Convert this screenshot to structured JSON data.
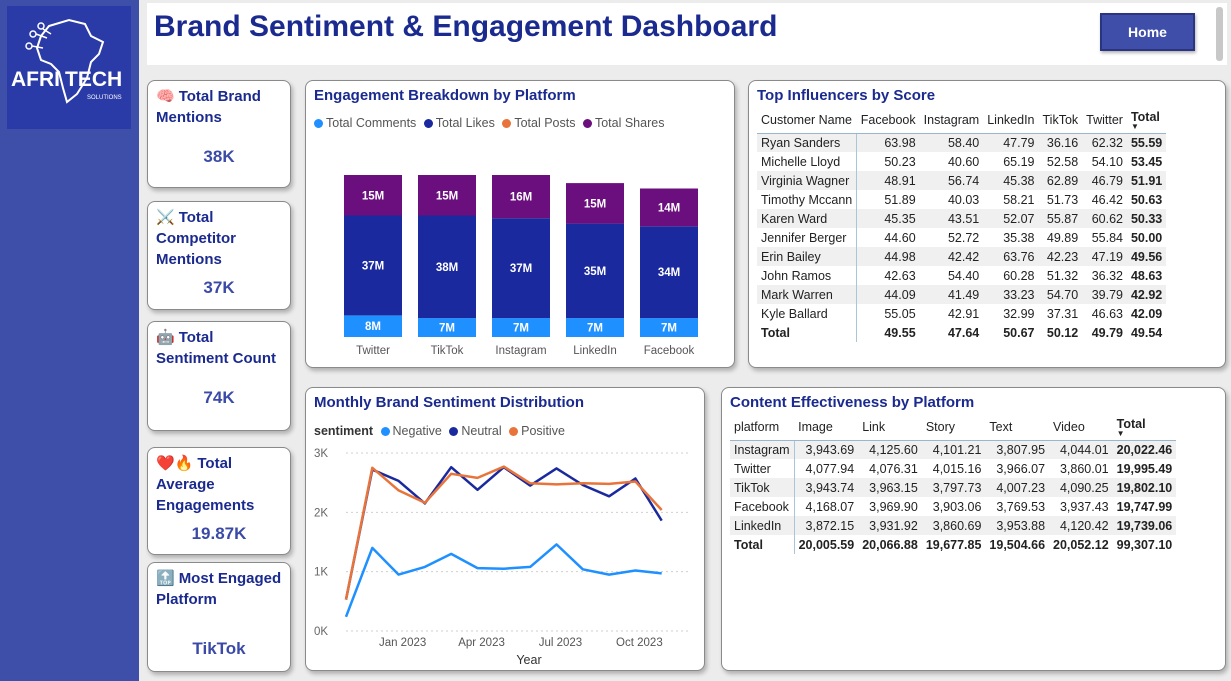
{
  "app": {
    "title": "Brand Sentiment & Engagement Dashboard",
    "home_label": "Home",
    "logo": {
      "line1": "AFRI",
      "line2": "TECH",
      "line3": "SOLUTIONS"
    }
  },
  "kpis": [
    {
      "title": "Total Brand Mentions",
      "value": "38K",
      "icon": "brain-emoji"
    },
    {
      "title": "Total Competitor Mentions",
      "value": "37K",
      "icon": "crossed-swords-emoji"
    },
    {
      "title": "Total Sentiment Count",
      "value": "74K",
      "icon": "robot-emoji"
    },
    {
      "title": "Total Average Engagements",
      "value": "19.87K",
      "icon": "heart-fire-emoji"
    },
    {
      "title": "Most Engaged Platform",
      "value": "TikTok",
      "icon": "top-arrow-emoji"
    }
  ],
  "engagement_chart": {
    "title": "Engagement Breakdown by Platform",
    "legend": [
      {
        "label": "Total Comments",
        "color": "#1e90ff"
      },
      {
        "label": "Total Likes",
        "color": "#1a2a9e"
      },
      {
        "label": "Total Posts",
        "color": "#e8743b"
      },
      {
        "label": "Total Shares",
        "color": "#6b0f7e"
      }
    ],
    "chart_data": {
      "type": "bar",
      "stacked": true,
      "categories": [
        "Twitter",
        "TikTok",
        "Instagram",
        "LinkedIn",
        "Facebook"
      ],
      "series": [
        {
          "name": "Total Comments",
          "values": [
            8,
            7,
            7,
            7,
            7
          ],
          "labels": [
            "8M",
            "7M",
            "7M",
            "7M",
            "7M"
          ]
        },
        {
          "name": "Total Likes",
          "values": [
            37,
            38,
            37,
            35,
            34
          ],
          "labels": [
            "37M",
            "38M",
            "37M",
            "35M",
            "34M"
          ]
        },
        {
          "name": "Total Shares",
          "values": [
            15,
            15,
            16,
            15,
            14
          ],
          "labels": [
            "15M",
            "15M",
            "16M",
            "15M",
            "14M"
          ]
        }
      ],
      "unit": "M"
    }
  },
  "sentiment_chart": {
    "title": "Monthly Brand Sentiment Distribution",
    "legend_title": "sentiment",
    "legend": [
      {
        "label": "Negative",
        "color": "#1e90ff"
      },
      {
        "label": "Neutral",
        "color": "#1a2a9e"
      },
      {
        "label": "Positive",
        "color": "#e8743b"
      }
    ],
    "chart_data": {
      "type": "line",
      "x": [
        "2022-11",
        "2022-12",
        "2023-01",
        "2023-02",
        "2023-03",
        "2023-04",
        "2023-05",
        "2023-06",
        "2023-07",
        "2023-08",
        "2023-09",
        "2023-10",
        "2023-11",
        "2023-12"
      ],
      "series": [
        {
          "name": "Negative",
          "values": [
            240,
            1400,
            950,
            1080,
            1300,
            1060,
            1050,
            1080,
            1460,
            1040,
            950,
            1020,
            970,
            null
          ]
        },
        {
          "name": "Neutral",
          "values": [
            530,
            2720,
            2530,
            2150,
            2760,
            2380,
            2760,
            2450,
            2740,
            2460,
            2270,
            2570,
            1860,
            null
          ]
        },
        {
          "name": "Positive",
          "values": [
            530,
            2750,
            2370,
            2160,
            2650,
            2580,
            2770,
            2490,
            2470,
            2490,
            2480,
            2520,
            2040,
            null
          ]
        }
      ],
      "xlabel": "Year",
      "xticks": [
        "Jan 2023",
        "Apr 2023",
        "Jul 2023",
        "Oct 2023"
      ],
      "yticks": [
        "0K",
        "1K",
        "2K",
        "3K"
      ],
      "ylim": [
        0,
        3000
      ],
      "grid": true
    }
  },
  "influencers": {
    "title": "Top Influencers by Score",
    "columns": [
      "Customer Name",
      "Facebook",
      "Instagram",
      "LinkedIn",
      "TikTok",
      "Twitter",
      "Total"
    ],
    "rows": [
      [
        "Ryan Sanders",
        "63.98",
        "58.40",
        "47.79",
        "36.16",
        "62.32",
        "55.59"
      ],
      [
        "Michelle Lloyd",
        "50.23",
        "40.60",
        "65.19",
        "52.58",
        "54.10",
        "53.45"
      ],
      [
        "Virginia Wagner",
        "48.91",
        "56.74",
        "45.38",
        "62.89",
        "46.79",
        "51.91"
      ],
      [
        "Timothy Mccann",
        "51.89",
        "40.03",
        "58.21",
        "51.73",
        "46.42",
        "50.63"
      ],
      [
        "Karen Ward",
        "45.35",
        "43.51",
        "52.07",
        "55.87",
        "60.62",
        "50.33"
      ],
      [
        "Jennifer Berger",
        "44.60",
        "52.72",
        "35.38",
        "49.89",
        "55.84",
        "50.00"
      ],
      [
        "Erin Bailey",
        "44.98",
        "42.42",
        "63.76",
        "42.23",
        "47.19",
        "49.56"
      ],
      [
        "John Ramos",
        "42.63",
        "54.40",
        "60.28",
        "51.32",
        "36.32",
        "48.63"
      ],
      [
        "Mark Warren",
        "44.09",
        "41.49",
        "33.23",
        "54.70",
        "39.79",
        "42.92"
      ],
      [
        "Kyle Ballard",
        "55.05",
        "42.91",
        "32.99",
        "37.31",
        "46.63",
        "42.09"
      ]
    ],
    "total": [
      "Total",
      "49.55",
      "47.64",
      "50.67",
      "50.12",
      "49.79",
      "49.54"
    ]
  },
  "content": {
    "title": "Content Effectiveness by Platform",
    "columns": [
      "platform",
      "Image",
      "Link",
      "Story",
      "Text",
      "Video",
      "Total"
    ],
    "rows": [
      [
        "Instagram",
        "3,943.69",
        "4,125.60",
        "4,101.21",
        "3,807.95",
        "4,044.01",
        "20,022.46"
      ],
      [
        "Twitter",
        "4,077.94",
        "4,076.31",
        "4,015.16",
        "3,966.07",
        "3,860.01",
        "19,995.49"
      ],
      [
        "TikTok",
        "3,943.74",
        "3,963.15",
        "3,797.73",
        "4,007.23",
        "4,090.25",
        "19,802.10"
      ],
      [
        "Facebook",
        "4,168.07",
        "3,969.90",
        "3,903.06",
        "3,769.53",
        "3,937.43",
        "19,747.99"
      ],
      [
        "LinkedIn",
        "3,872.15",
        "3,931.92",
        "3,860.69",
        "3,953.88",
        "4,120.42",
        "19,739.06"
      ]
    ],
    "total": [
      "Total",
      "20,005.59",
      "20,066.88",
      "19,677.85",
      "19,504.66",
      "20,052.12",
      "99,307.10"
    ]
  }
}
